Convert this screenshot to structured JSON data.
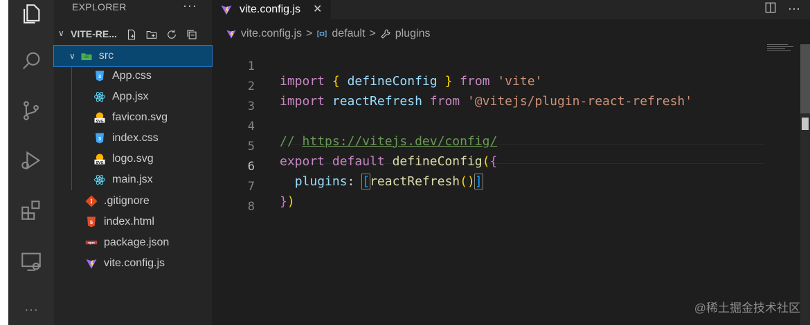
{
  "sidebar": {
    "title": "EXPLORER",
    "more": "···",
    "folder": {
      "name": "VITE-RE...",
      "chevron": "∨"
    },
    "items": [
      {
        "label": "src",
        "icon": "folder-src-icon"
      },
      {
        "label": "App.css",
        "icon": "css-file-icon"
      },
      {
        "label": "App.jsx",
        "icon": "react-file-icon"
      },
      {
        "label": "favicon.svg",
        "icon": "svg-file-icon"
      },
      {
        "label": "index.css",
        "icon": "css-file-icon"
      },
      {
        "label": "logo.svg",
        "icon": "svg-file-icon"
      },
      {
        "label": "main.jsx",
        "icon": "react-file-icon"
      },
      {
        "label": ".gitignore",
        "icon": "git-file-icon"
      },
      {
        "label": "index.html",
        "icon": "html-file-icon"
      },
      {
        "label": "package.json",
        "icon": "npm-file-icon"
      },
      {
        "label": "vite.config.js",
        "icon": "vite-file-icon"
      }
    ]
  },
  "tab": {
    "label": "vite.config.js",
    "close": "✕"
  },
  "breadcrumb": {
    "file": "vite.config.js",
    "symbol1": "default",
    "symbol2": "plugins",
    "sep": ">"
  },
  "editor": {
    "line_numbers": [
      "1",
      "2",
      "3",
      "4",
      "5",
      "6",
      "7",
      "8"
    ],
    "active_line": 6
  },
  "watermark": "@稀土掘金技术社区",
  "colors": {
    "accent": "#2b79d0",
    "selection": "#094771",
    "background": "#1e1e1e",
    "sidebar": "#252526"
  }
}
